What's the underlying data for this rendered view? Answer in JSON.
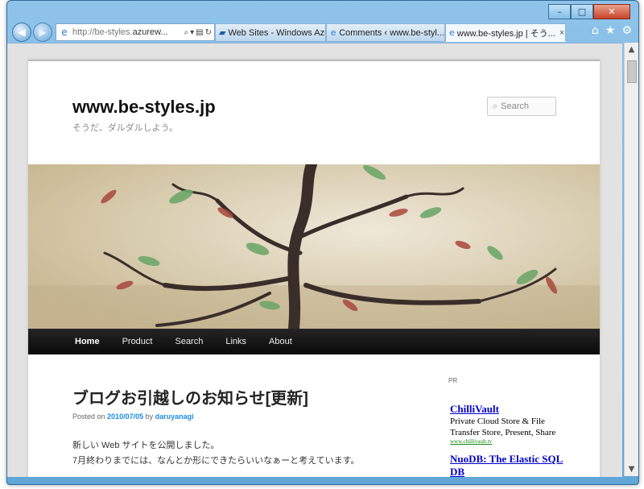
{
  "browser": {
    "address_host": "http://be-styles.",
    "address_rest": "azurew...",
    "tabs": [
      {
        "label": "Web Sites - Windows Azure",
        "icon": "azure-icon"
      },
      {
        "label": "Comments ‹ www.be-styl...",
        "icon": "ie-page-icon"
      },
      {
        "label": "www.be-styles.jp | そう...",
        "icon": "ie-page-icon",
        "active": true
      }
    ],
    "window_buttons": {
      "minimize": "–",
      "maximize": "□",
      "close": "✕"
    },
    "tab_close": "×",
    "tools": {
      "home": "⌂",
      "favorites": "★",
      "settings": "⚙"
    }
  },
  "site": {
    "title": "www.be-styles.jp",
    "description": "そうだ、ダルダルしよう。",
    "search_placeholder": "Search"
  },
  "nav": {
    "items": [
      "Home",
      "Product",
      "Search",
      "Links",
      "About"
    ]
  },
  "post": {
    "title": "ブログお引越しのお知らせ[更新]",
    "posted_on_label": "Posted on",
    "date": "2010/07/05",
    "by_label": "by",
    "author": "daruyanagi",
    "lines": [
      "新しい Web サイトを公開しました。",
      "7月終わりまでには、なんとか形にできたらいいなぁーと考えています。"
    ]
  },
  "sidebar": {
    "pr_label": "PR",
    "ads": [
      {
        "title": "ChilliVault",
        "desc_lines": [
          "Private Cloud Store & File",
          "Transfer Store, Present, Share"
        ],
        "url": "www.chillivault.tv"
      },
      {
        "title_lines": [
          "NuoDB: The Elastic SQL",
          "DB"
        ]
      }
    ]
  },
  "colors": {
    "link": "#1b8be0",
    "nav_bg": "#111111",
    "ad_link": "#0000cc",
    "ad_url": "#118811"
  }
}
